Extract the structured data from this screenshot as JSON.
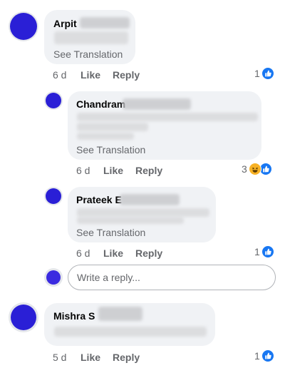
{
  "comments": [
    {
      "author": "Arpit",
      "see_translation": "See Translation",
      "time": "6 d",
      "like": "Like",
      "reply": "Reply",
      "reaction_count": "1",
      "replies": [
        {
          "author": "Chandram",
          "see_translation": "See Translation",
          "time": "6 d",
          "like": "Like",
          "reply": "Reply",
          "reaction_count": "3"
        },
        {
          "author": "Prateek E",
          "see_translation": "See Translation",
          "time": "6 d",
          "like": "Like",
          "reply": "Reply",
          "reaction_count": "1"
        }
      ],
      "reply_box": {
        "placeholder": "Write a reply..."
      }
    },
    {
      "author": "Mishra S",
      "time": "5 d",
      "like": "Like",
      "reply": "Reply",
      "reaction_count": "1"
    }
  ],
  "icons": {
    "like": "like-icon",
    "haha": "haha-icon"
  },
  "colors": {
    "facebook_blue": "#1877f2",
    "avatar_blue": "#2a1fd6",
    "bubble_bg": "#f0f2f5",
    "meta_text": "#65676b"
  }
}
